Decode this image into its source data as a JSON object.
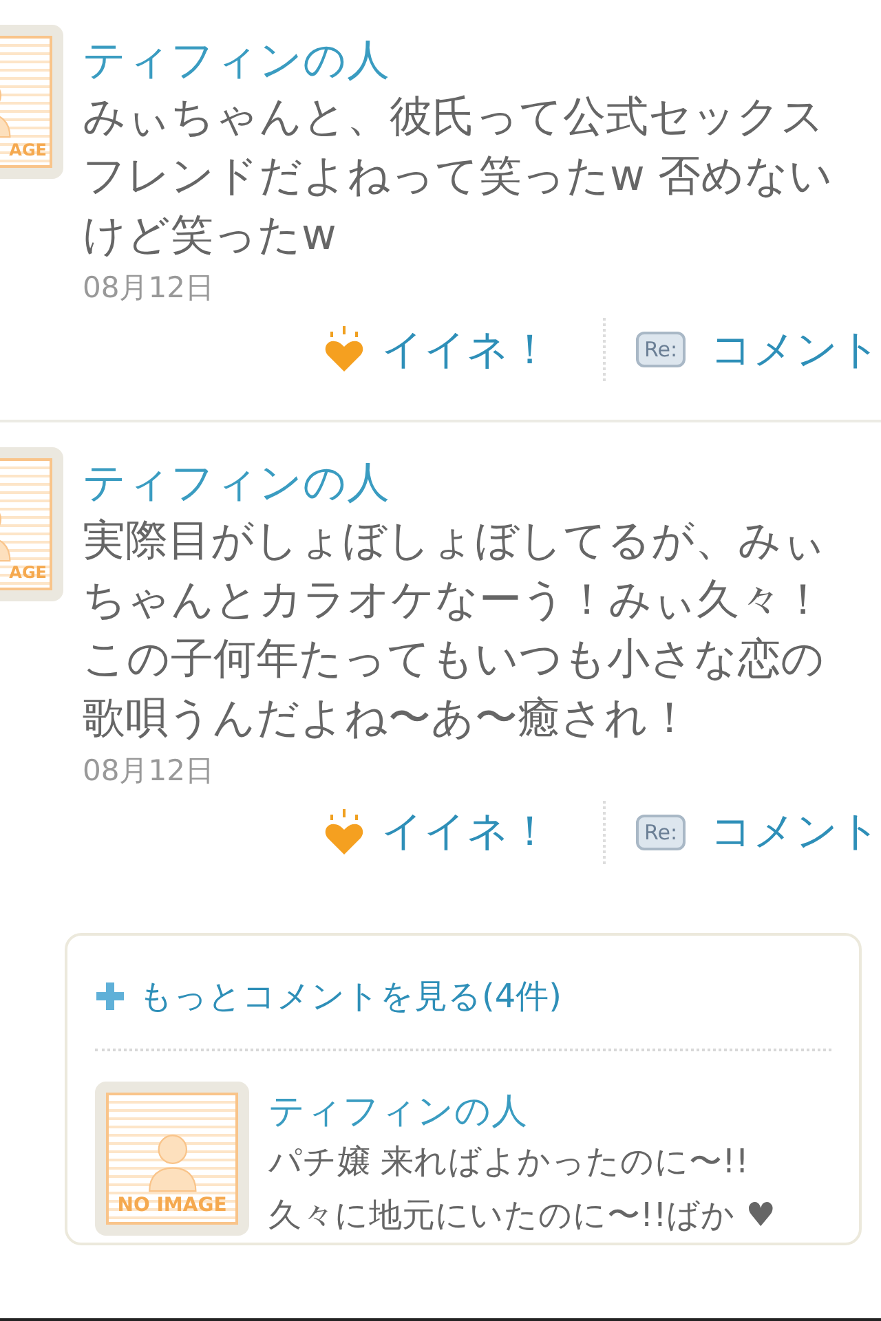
{
  "posts": [
    {
      "author": "ティフィンの人",
      "avatar_text": "AGE",
      "body": "みぃちゃんと、彼氏って公式セックスフレンドだよねって笑ったw 否めないけど笑ったw",
      "date": "08月12日",
      "like_label": "イイネ！",
      "re_badge": "Re:",
      "comment_label": "コメント"
    },
    {
      "author": "ティフィンの人",
      "avatar_text": "AGE",
      "body": "実際目がしょぼしょぼしてるが、みぃちゃんとカラオケなーう！みぃ久々！この子何年たってもいつも小さな恋の歌唄うんだよね〜あ〜癒され！",
      "date": "08月12日",
      "like_label": "イイネ！",
      "re_badge": "Re:",
      "comment_label": "コメント",
      "comments": {
        "more_label": "もっとコメントを見る(4件)",
        "items": [
          {
            "author": "ティフィンの人",
            "avatar_text": "NO IMAGE",
            "body": "パチ嬢 来ればよかったのに〜!! 久々に地元にいたのに〜!!ばか ♥"
          }
        ]
      }
    }
  ]
}
